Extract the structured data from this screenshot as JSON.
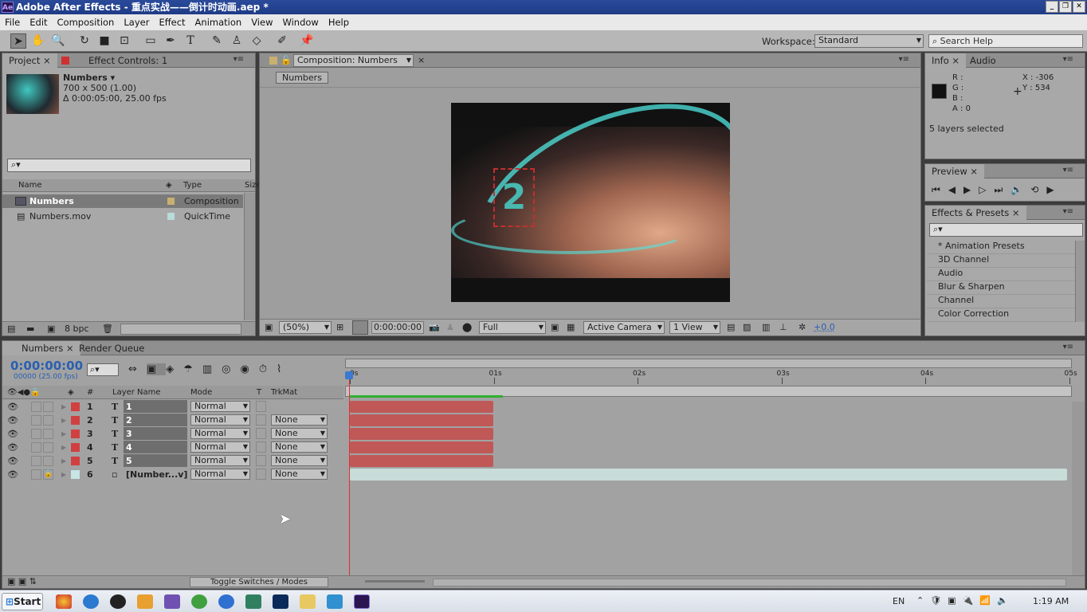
{
  "window": {
    "title": "Adobe After Effects - 重点实战——倒计时动画.aep *",
    "logo": "Ae"
  },
  "menu": [
    "File",
    "Edit",
    "Composition",
    "Layer",
    "Effect",
    "Animation",
    "View",
    "Window",
    "Help"
  ],
  "toolbar": {
    "workspace_label": "Workspace:",
    "workspace_value": "Standard",
    "search_placeholder": "Search Help"
  },
  "project": {
    "tab": "Project",
    "effect_tab": "Effect Controls: 1",
    "item_name": "Numbers ▾",
    "item_size": "700 x 500 (1.00)",
    "item_duration": "Δ 0:00:05:00, 25.00 fps",
    "columns": {
      "name": "Name",
      "type": "Type",
      "size": "Size"
    },
    "items": [
      {
        "name": "Numbers",
        "type": "Composition",
        "color": "#c8b070"
      },
      {
        "name": "Numbers.mov",
        "type": "QuickTime",
        "color": "#b8dcdc"
      }
    ],
    "bpc": "8 bpc"
  },
  "composition": {
    "tab": "Composition: Numbers",
    "breadcrumb": "Numbers",
    "zoom": "(50%)",
    "timecode": "0:00:00:00",
    "resolution": "Full",
    "camera": "Active Camera",
    "views": "1 View",
    "exposure": "+0.0"
  },
  "info": {
    "tab": "Info",
    "audio_tab": "Audio",
    "r": "R :",
    "g": "G :",
    "b": "B :",
    "a": "A : 0",
    "x": "X : -306",
    "y": "Y : 534",
    "status": "5 layers selected"
  },
  "preview": {
    "tab": "Preview"
  },
  "effects": {
    "tab": "Effects & Presets",
    "items": [
      "* Animation Presets",
      "3D Channel",
      "Audio",
      "Blur & Sharpen",
      "Channel",
      "Color Correction"
    ]
  },
  "timeline": {
    "tab": "Numbers",
    "render_tab": "Render Queue",
    "timecode": "0:00:00:00",
    "frames": "00000 (25.00 fps)",
    "columns": {
      "num": "#",
      "name": "Layer Name",
      "mode": "Mode",
      "t": "T",
      "trkmat": "TrkMat"
    },
    "ruler": [
      "0s",
      "01s",
      "02s",
      "03s",
      "04s",
      "05s"
    ],
    "layers": [
      {
        "num": "1",
        "name": "1",
        "mode": "Normal",
        "trkmat": "",
        "color": "#d04040",
        "type": "T"
      },
      {
        "num": "2",
        "name": "2",
        "mode": "Normal",
        "trkmat": "None",
        "color": "#d04040",
        "type": "T"
      },
      {
        "num": "3",
        "name": "3",
        "mode": "Normal",
        "trkmat": "None",
        "color": "#d04040",
        "type": "T"
      },
      {
        "num": "4",
        "name": "4",
        "mode": "Normal",
        "trkmat": "None",
        "color": "#d04040",
        "type": "T"
      },
      {
        "num": "5",
        "name": "5",
        "mode": "Normal",
        "trkmat": "None",
        "color": "#d04040",
        "type": "T"
      },
      {
        "num": "6",
        "name": "[Number...v]",
        "mode": "Normal",
        "trkmat": "None",
        "color": "#c8e4e4",
        "type": "footage"
      }
    ],
    "toggle": "Toggle Switches / Modes"
  },
  "taskbar": {
    "start": "Start",
    "lang": "EN",
    "time": "1:19 AM"
  }
}
